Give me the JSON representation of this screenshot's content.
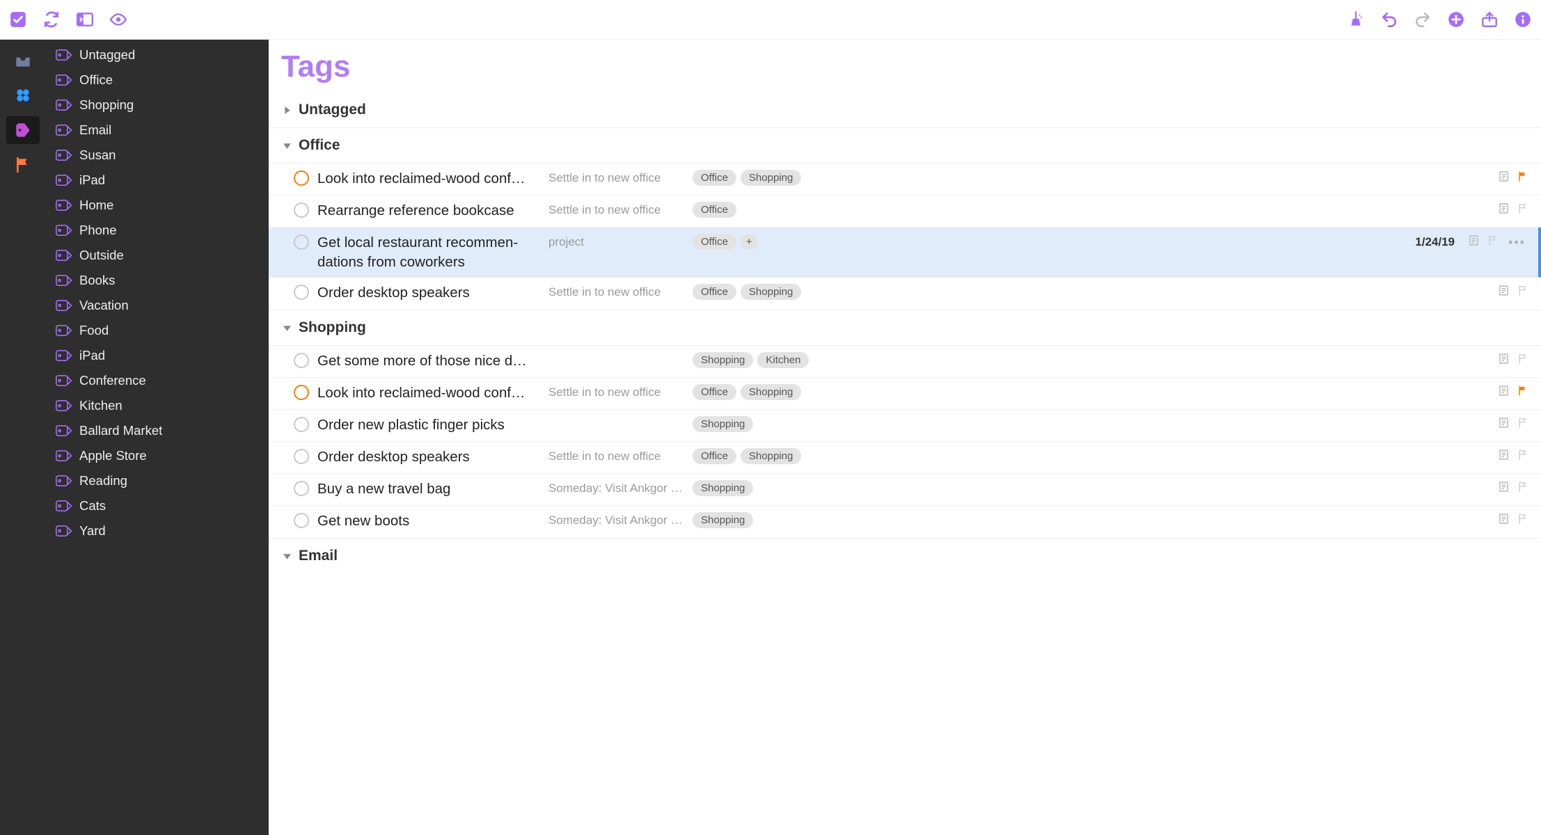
{
  "page_title": "Tags",
  "sidebar_tags": [
    "Untagged",
    "Office",
    "Shopping",
    "Email",
    "Susan",
    "iPad",
    "Home",
    "Phone",
    "Outside",
    "Books",
    "Vacation",
    "Food",
    "iPad",
    "Conference",
    "Kitchen",
    "Ballard Market",
    "Apple Store",
    "Reading",
    "Cats",
    "Yard"
  ],
  "sections": [
    {
      "name": "Untagged",
      "expanded": false,
      "tasks": []
    },
    {
      "name": "Office",
      "expanded": true,
      "tasks": [
        {
          "title": "Look into reclaimed-wood conf…",
          "project": "Settle in to new office",
          "tags": [
            "Office",
            "Shopping"
          ],
          "flagged": true,
          "note": true,
          "flag_on": true,
          "wrap": false
        },
        {
          "title": "Rearrange reference bookcase",
          "project": "Settle in to new office",
          "tags": [
            "Office"
          ],
          "flagged": false,
          "note": true,
          "flag_on": false,
          "wrap": false
        },
        {
          "title": "Get local restaurant recommen-dations from coworkers",
          "project": "project",
          "tags": [
            "Office"
          ],
          "plus": true,
          "date": "1/24/19",
          "flagged": false,
          "note": true,
          "flag_on": false,
          "selected": true,
          "more": true,
          "wrap": true
        },
        {
          "title": "Order desktop speakers",
          "project": "Settle in to new office",
          "tags": [
            "Office",
            "Shopping"
          ],
          "flagged": false,
          "note": true,
          "flag_on": false,
          "wrap": false
        }
      ]
    },
    {
      "name": "Shopping",
      "expanded": true,
      "tasks": [
        {
          "title": "Get some more of those nice d…",
          "project": "",
          "tags": [
            "Shopping",
            "Kitchen"
          ],
          "flagged": false,
          "note": true,
          "flag_on": false,
          "wrap": false
        },
        {
          "title": "Look into reclaimed-wood conf…",
          "project": "Settle in to new office",
          "tags": [
            "Office",
            "Shopping"
          ],
          "flagged": true,
          "note": true,
          "flag_on": true,
          "wrap": false
        },
        {
          "title": "Order new plastic finger picks",
          "project": "",
          "tags": [
            "Shopping"
          ],
          "flagged": false,
          "note": true,
          "flag_on": false,
          "wrap": false
        },
        {
          "title": "Order desktop speakers",
          "project": "Settle in to new office",
          "tags": [
            "Office",
            "Shopping"
          ],
          "flagged": false,
          "note": true,
          "flag_on": false,
          "wrap": false
        },
        {
          "title": "Buy a new travel bag",
          "project": "Someday: Visit Ankgor …",
          "tags": [
            "Shopping"
          ],
          "flagged": false,
          "note": true,
          "flag_on": false,
          "wrap": false
        },
        {
          "title": "Get new boots",
          "project": "Someday: Visit Ankgor …",
          "tags": [
            "Shopping"
          ],
          "flagged": false,
          "note": true,
          "flag_on": false,
          "wrap": false
        }
      ]
    },
    {
      "name": "Email",
      "expanded": true,
      "tasks": []
    }
  ]
}
